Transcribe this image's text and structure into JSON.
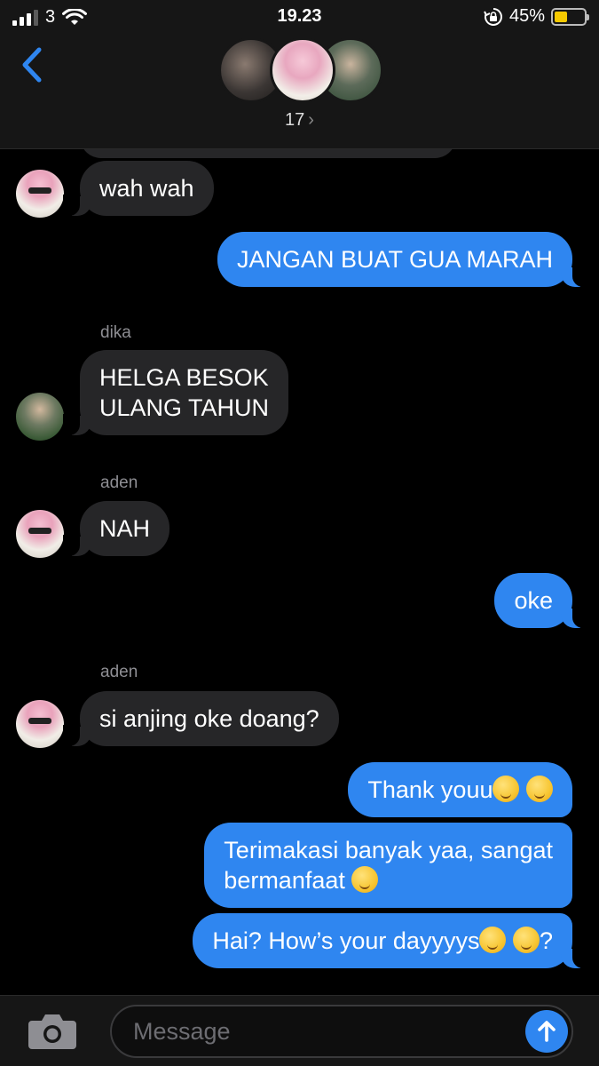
{
  "status_bar": {
    "carrier": "3",
    "time": "19.23",
    "battery": "45%",
    "battery_level": 0.45,
    "icons": [
      "signal-icon",
      "wifi-icon",
      "rotation-lock-icon",
      "battery-icon"
    ]
  },
  "header": {
    "back_icon": "chevron-left-icon",
    "member_count": "17",
    "count_chevron": "›"
  },
  "messages": [
    {
      "direction": "in",
      "sender": "",
      "text": "wah wah"
    },
    {
      "direction": "out",
      "text": "JANGAN BUAT GUA MARAH"
    },
    {
      "direction": "in",
      "sender": "dika",
      "line1": "HELGA BESOK",
      "line2": "ULANG TAHUN"
    },
    {
      "direction": "in",
      "sender": "aden",
      "text": "NAH"
    },
    {
      "direction": "out",
      "text": "oke"
    },
    {
      "direction": "in",
      "sender": "aden",
      "text": "si anjing oke doang?"
    },
    {
      "direction": "out",
      "text": "Thank youu",
      "emoji": [
        "smiling-face-icon",
        "smiling-face-icon"
      ]
    },
    {
      "direction": "out",
      "line1": "Terimakasi banyak yaa, sangat",
      "line2": "bermanfaat",
      "emoji": [
        "smiling-face-icon"
      ]
    },
    {
      "direction": "out",
      "text": "Hai? How’s your dayyyys",
      "suffix": "?",
      "emoji": [
        "winking-face-icon",
        "winking-face-icon"
      ]
    }
  ],
  "input": {
    "placeholder": "Message",
    "camera_icon": "camera-icon",
    "send_icon": "arrow-up-icon"
  },
  "colors": {
    "accent": "#2f86f0",
    "incoming_bubble": "#262628",
    "bar_background": "#161616"
  }
}
